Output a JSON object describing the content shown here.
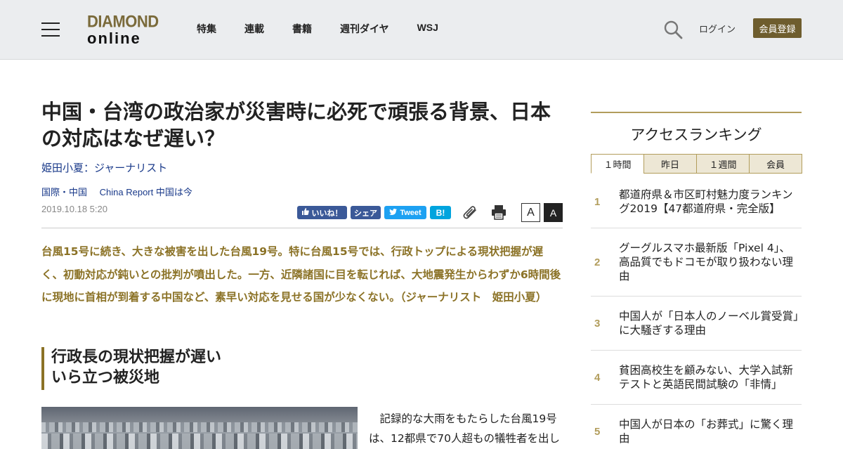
{
  "header": {
    "logo_line1": "DIAMOND",
    "logo_line2": "online",
    "nav": [
      "特集",
      "連載",
      "書籍",
      "週刊ダイヤ",
      "WSJ"
    ],
    "login": "ログイン",
    "register": "会員登録"
  },
  "article": {
    "title": "中国・台湾の政治家が災害時に必死で頑張る背景、日本の対応はなぜ遅い？",
    "author": "姫田小夏：ジャーナリスト",
    "categories": [
      "国際・中国",
      "China Report 中国は今"
    ],
    "date": "2019.10.18 5:20",
    "share": {
      "like": "いいね！",
      "share": "シェア",
      "tweet": "Tweet",
      "hatena": "B!"
    },
    "font_small": "A",
    "font_large": "A",
    "lead": "台風15号に続き、大きな被害を出した台風19号。特に台風15号では、行政トップによる現状把握が遅く、初動対応が鈍いとの批判が噴出した。一方、近隣諸国に目を転じれば、大地震発生からわずか6時間後に現地に首相が到着する中国など、素早い対応を見せる国が少なくない。（ジャーナリスト　姫田小夏）",
    "heading_line1": "行政長の現状把握が遅い",
    "heading_line2": "いら立つ被災地",
    "body": "記録的な大雨をもたらした台風19号は、12都県で70人超もの犠牲者を出し"
  },
  "sidebar": {
    "ranking_title": "アクセスランキング",
    "tabs": [
      "１時間",
      "昨日",
      "１週間",
      "会員"
    ],
    "active_tab": 0,
    "items": [
      {
        "rank": "1",
        "text": "都道府県＆市区町村魅力度ランキング2019【47都道府県・完全版】"
      },
      {
        "rank": "2",
        "text": "グーグルスマホ最新版「Pixel 4」、高品質でもドコモが取り扱わない理由"
      },
      {
        "rank": "3",
        "text": "中国人が「日本人のノーベル賞受賞」に大騒ぎする理由"
      },
      {
        "rank": "4",
        "text": "貧困高校生を顧みない、大学入試新テストと英語民間試験の「非情」"
      },
      {
        "rank": "5",
        "text": "中国人が日本の「お葬式」に驚く理由"
      }
    ]
  },
  "colors": {
    "header_bg": "#ebedef",
    "accent_gold": "#b29d5c",
    "lead_text": "#8b7226",
    "register_bg": "#6e5d2e",
    "link_blue": "#1a3a8a",
    "facebook": "#3b5998",
    "twitter": "#1da1f2",
    "hatena": "#00a4de"
  }
}
